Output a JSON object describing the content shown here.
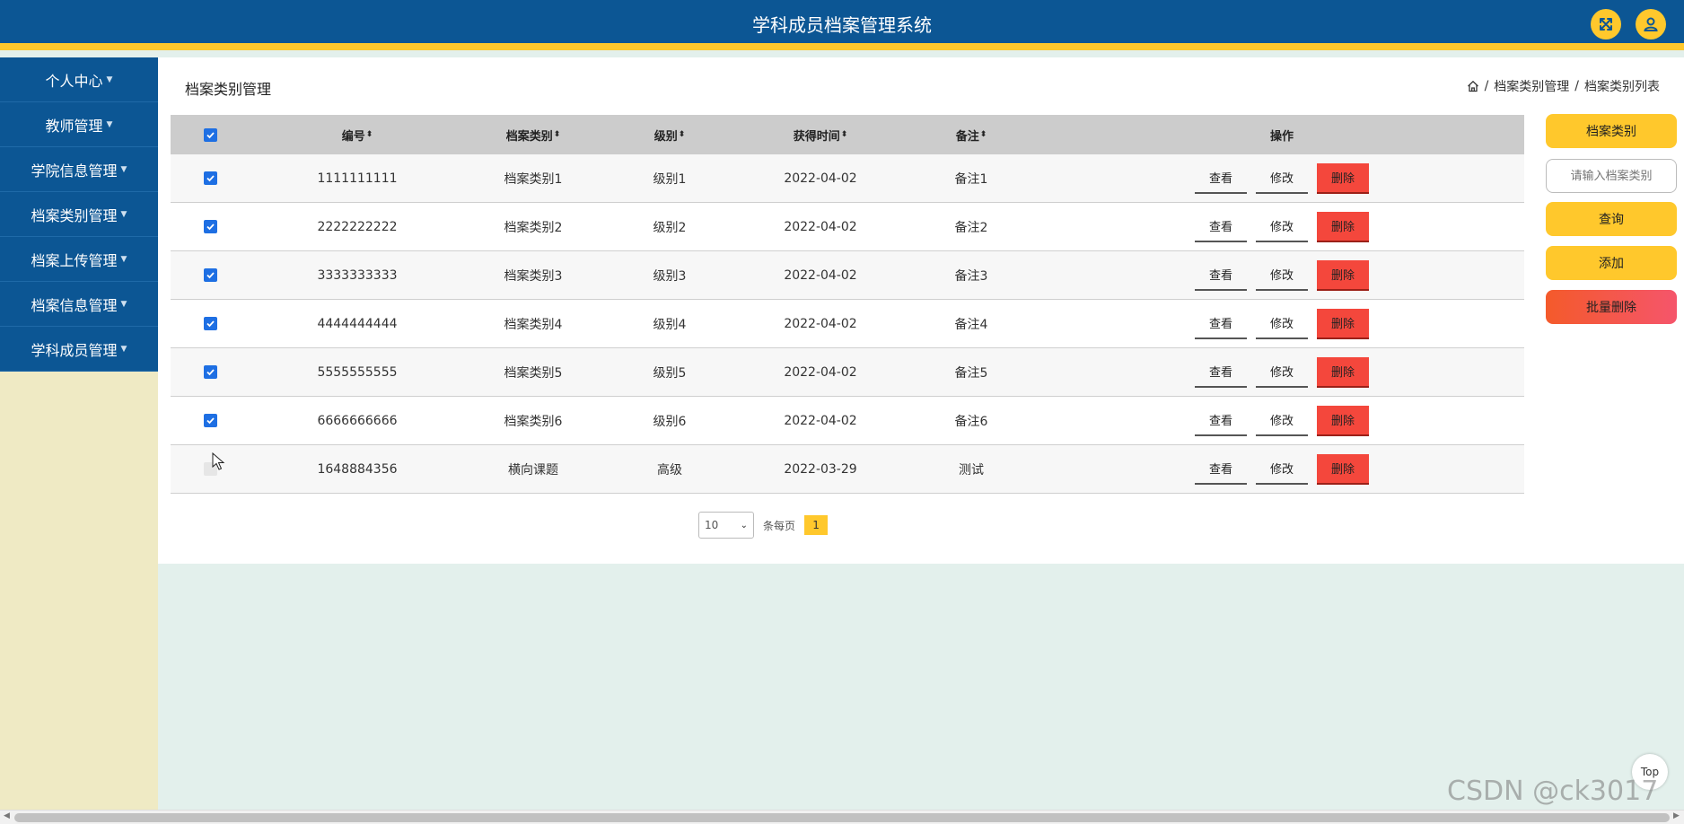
{
  "header": {
    "title": "学科成员档案管理系统",
    "fullscreen_icon": "expand-icon",
    "user_icon": "user-icon",
    "accent": "#ffc82c",
    "bg": "#0c5694"
  },
  "sidebar": {
    "items": [
      {
        "label": "个人中心"
      },
      {
        "label": "教师管理"
      },
      {
        "label": "学院信息管理"
      },
      {
        "label": "档案类别管理"
      },
      {
        "label": "档案上传管理"
      },
      {
        "label": "档案信息管理"
      },
      {
        "label": "学科成员管理"
      }
    ]
  },
  "page": {
    "title": "档案类别管理",
    "breadcrumb": [
      "档案类别管理",
      "档案类别列表"
    ],
    "breadcrumb_sep": "/"
  },
  "table": {
    "headers": {
      "id": "编号",
      "type": "档案类别",
      "level": "级别",
      "time": "获得时间",
      "note": "备注",
      "ops": "操作"
    },
    "sort_glyph": "⬍",
    "rows": [
      {
        "checked": true,
        "id": "1111111111",
        "type": "档案类别1",
        "level": "级别1",
        "time": "2022-04-02",
        "note": "备注1"
      },
      {
        "checked": true,
        "id": "2222222222",
        "type": "档案类别2",
        "level": "级别2",
        "time": "2022-04-02",
        "note": "备注2"
      },
      {
        "checked": true,
        "id": "3333333333",
        "type": "档案类别3",
        "level": "级别3",
        "time": "2022-04-02",
        "note": "备注3"
      },
      {
        "checked": true,
        "id": "4444444444",
        "type": "档案类别4",
        "level": "级别4",
        "time": "2022-04-02",
        "note": "备注4"
      },
      {
        "checked": true,
        "id": "5555555555",
        "type": "档案类别5",
        "level": "级别5",
        "time": "2022-04-02",
        "note": "备注5"
      },
      {
        "checked": true,
        "id": "6666666666",
        "type": "档案类别6",
        "level": "级别6",
        "time": "2022-04-02",
        "note": "备注6"
      },
      {
        "checked": false,
        "id": "1648884356",
        "type": "横向课题",
        "level": "高级",
        "time": "2022-03-29",
        "note": "测试"
      }
    ],
    "op_labels": {
      "view": "查看",
      "edit": "修改",
      "delete": "删除"
    }
  },
  "pager": {
    "page_size": "10",
    "per_page_label": "条每页",
    "current_page": "1"
  },
  "right_panel": {
    "category_button": "档案类别",
    "search_placeholder": "请输入档案类别",
    "search_button": "查询",
    "add_button": "添加",
    "batch_delete_button": "批量删除"
  },
  "misc": {
    "top_button": "Top",
    "watermark": "CSDN @ck3017"
  }
}
